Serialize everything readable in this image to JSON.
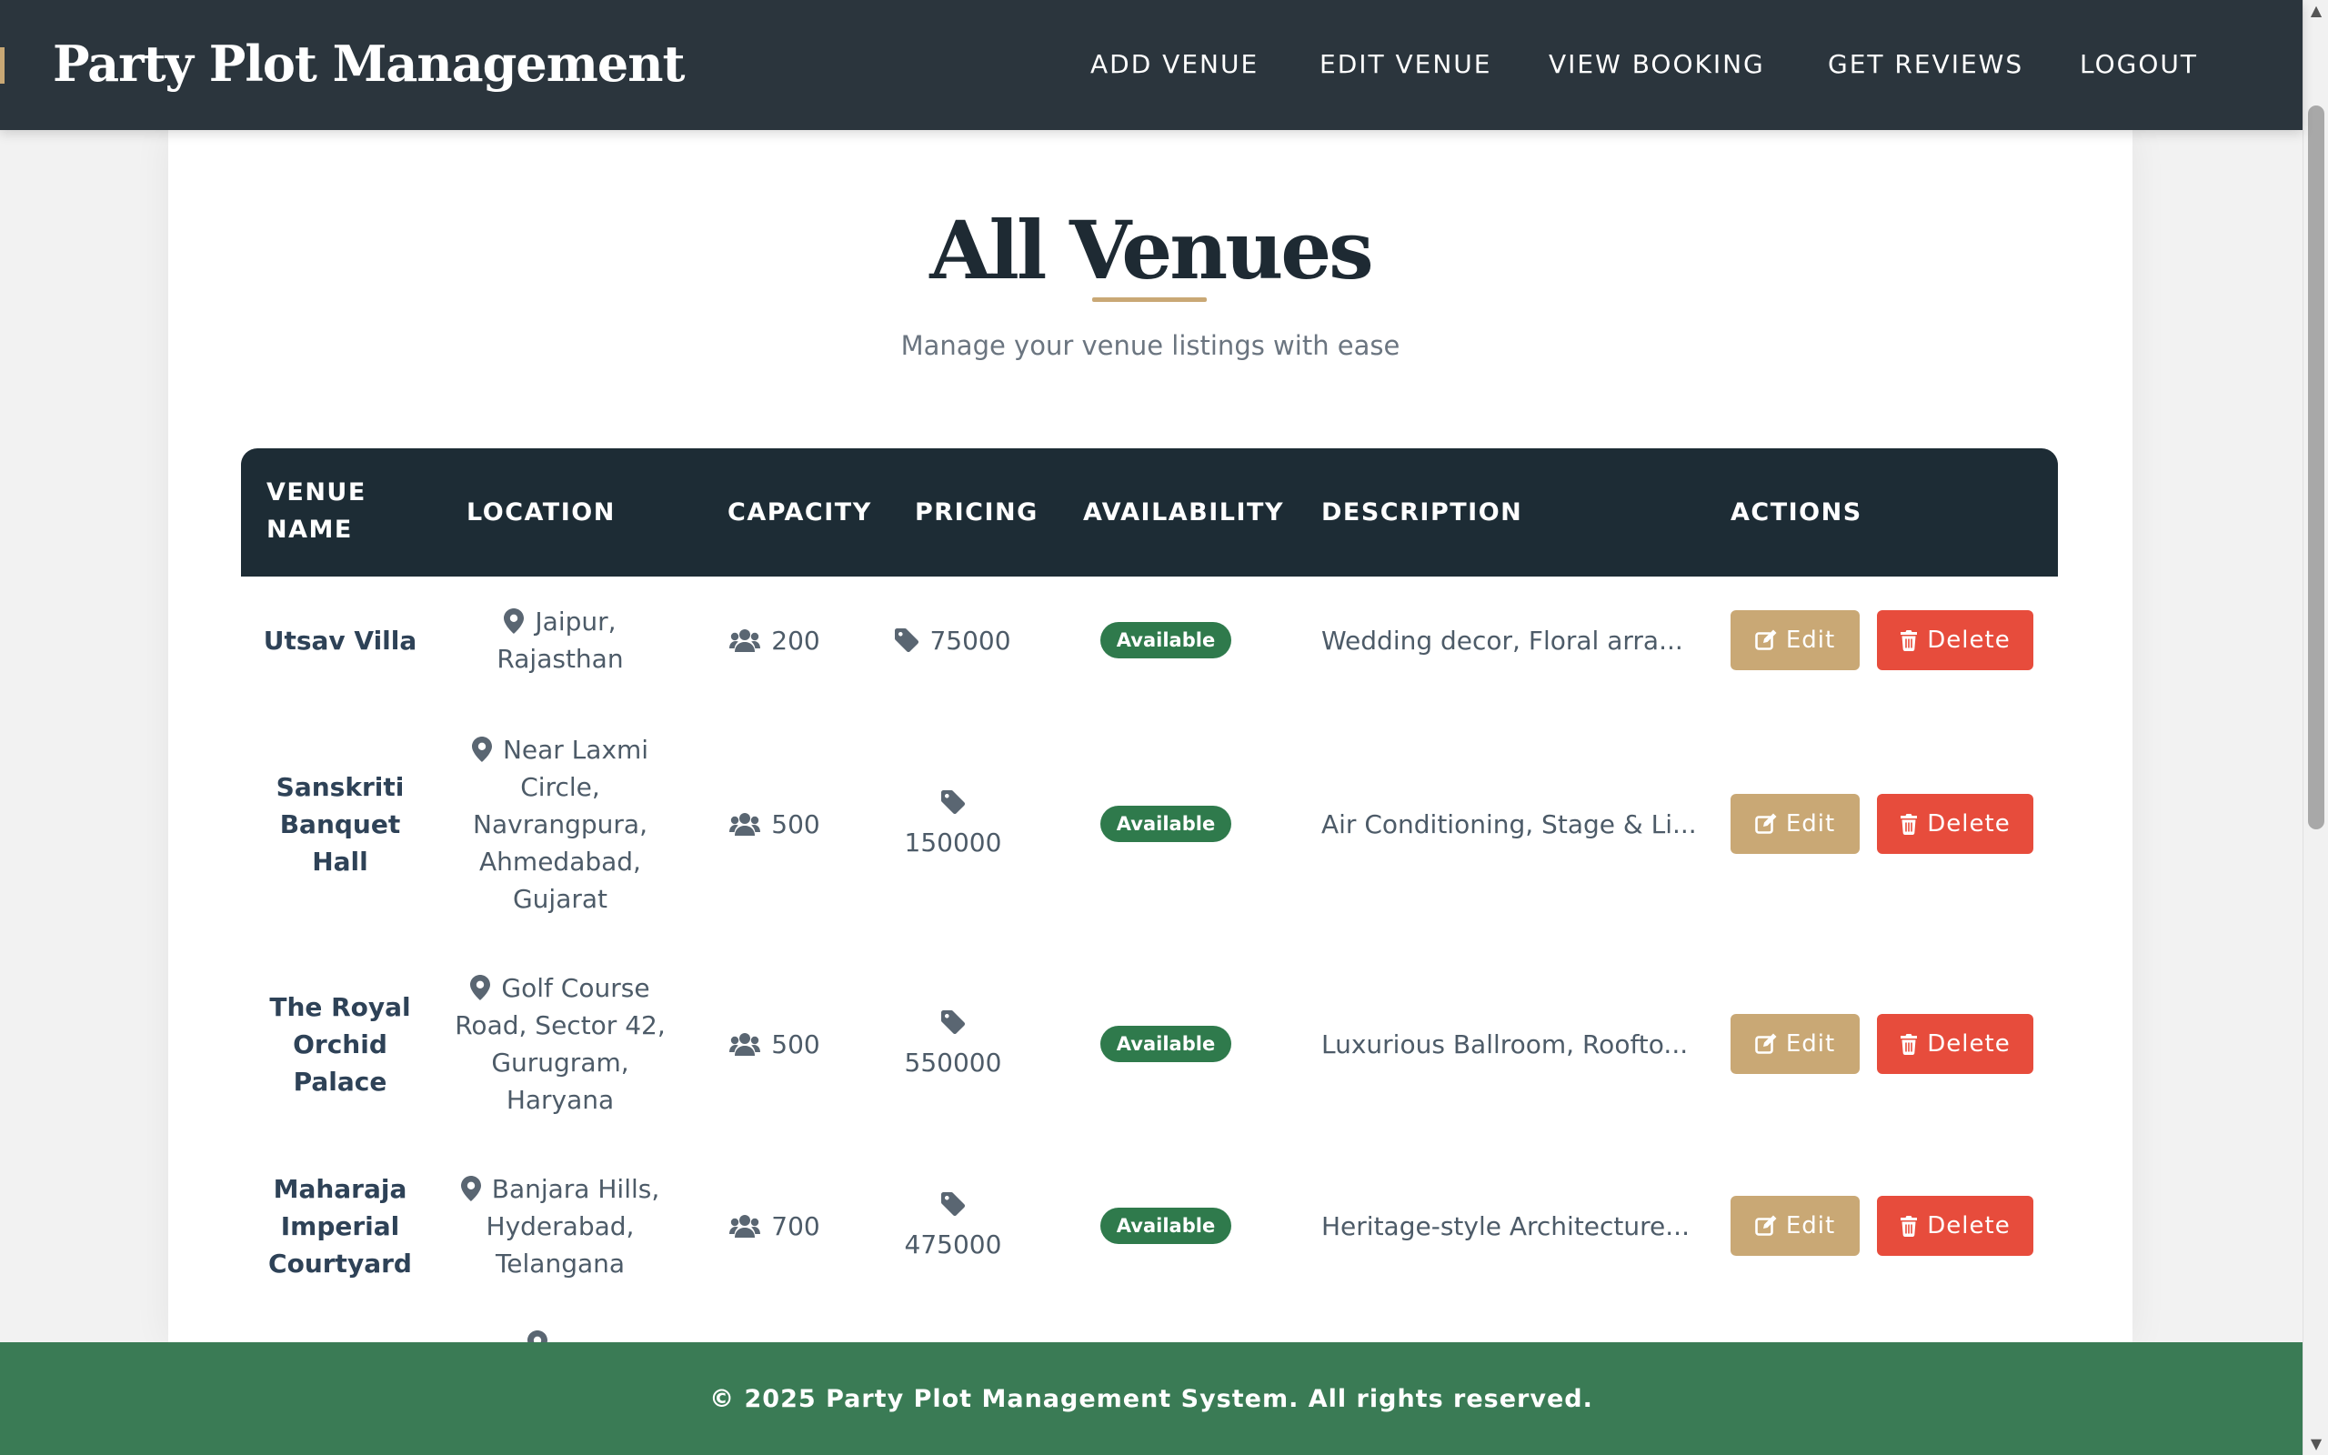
{
  "header": {
    "brand": "Party Plot Management",
    "nav": [
      "ADD VENUE",
      "EDIT VENUE",
      "VIEW BOOKING",
      "GET REVIEWS",
      "LOGOUT"
    ]
  },
  "main": {
    "title": "All Venues",
    "subtitle": "Manage your venue listings with ease"
  },
  "table": {
    "headers": {
      "venue_name_line1": "VENUE",
      "venue_name_line2": "NAME",
      "location": "LOCATION",
      "capacity": "CAPACITY",
      "pricing": "PRICING",
      "availability": "AVAILABILITY",
      "description": "DESCRIPTION",
      "actions": "ACTIONS"
    },
    "rows": [
      {
        "name_lines": [
          "Utsav Villa"
        ],
        "location_lines": [
          "Jaipur,",
          "Rajasthan"
        ],
        "capacity": "200",
        "price": "75000",
        "availability": "Available",
        "description": "Wedding decor, Floral arra...",
        "edit": "Edit",
        "delete": "Delete"
      },
      {
        "name_lines": [
          "Sanskriti",
          "Banquet",
          "Hall"
        ],
        "location_lines": [
          "Near Laxmi",
          "Circle,",
          "Navrangpura,",
          "Ahmedabad,",
          "Gujarat"
        ],
        "capacity": "500",
        "price": "150000",
        "availability": "Available",
        "description": "Air Conditioning, Stage & Li...",
        "edit": "Edit",
        "delete": "Delete"
      },
      {
        "name_lines": [
          "The Royal",
          "Orchid",
          "Palace"
        ],
        "location_lines": [
          "Golf Course",
          "Road, Sector 42,",
          "Gurugram,",
          "Haryana"
        ],
        "capacity": "500",
        "price": "550000",
        "availability": "Available",
        "description": "Luxurious Ballroom, Roofto...",
        "edit": "Edit",
        "delete": "Delete"
      },
      {
        "name_lines": [
          "Maharaja",
          "Imperial",
          "Courtyard"
        ],
        "location_lines": [
          "Banjara Hills,",
          "Hyderabad,",
          "Telangana"
        ],
        "capacity": "700",
        "price": "475000",
        "availability": "Available",
        "description": "Heritage-style Architecture...",
        "edit": "Edit",
        "delete": "Delete"
      }
    ]
  },
  "footer": {
    "text": "© 2025 Party Plot Management System. All rights reserved."
  },
  "colors": {
    "header_bg": "#2b353d",
    "accent_gold": "#c9a875",
    "table_header_bg": "#1d2c35",
    "available_green": "#2f7a4c",
    "delete_red": "#e74c3c",
    "footer_green": "#3a7b55"
  },
  "icons": {
    "location": "map-pin-icon",
    "capacity": "users-icon",
    "price": "tag-icon",
    "edit": "edit-icon",
    "delete": "trash-icon"
  }
}
